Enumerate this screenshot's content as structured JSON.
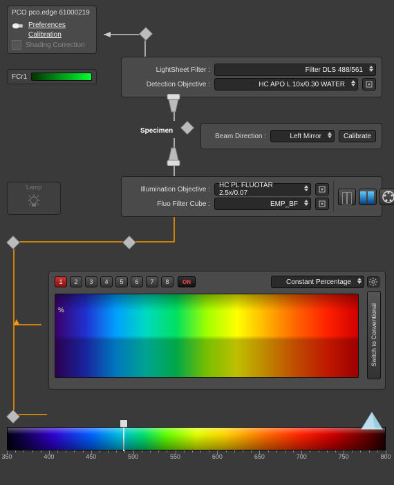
{
  "camera": {
    "title": "PCO pco.edge 61000219",
    "preferences": "Preferences",
    "calibration": "Calibration",
    "shading": "Shading Correction"
  },
  "fcr": {
    "label": "FCr1"
  },
  "detection": {
    "lightsheet_label": "LightSheet Filter :",
    "lightsheet_value": "Filter DLS  488/561",
    "objective_label": "Detection Objective :",
    "objective_value": "HC APO L   10x/0.30 WATER"
  },
  "specimen_label": "Specimen",
  "beam": {
    "label": "Beam Direction :",
    "value": "Left Mirror",
    "calibrate": "Calibrate"
  },
  "illumination": {
    "objective_label": "Illumination Objective :",
    "objective_value": "HC PL FLUOTAR   2.5x/0.07",
    "cube_label": "Fluo Filter Cube :",
    "cube_value": "EMP_BF"
  },
  "lamp": {
    "title": "Lamp"
  },
  "laser": {
    "buttons": [
      "1",
      "2",
      "3",
      "4",
      "5",
      "6",
      "7",
      "8"
    ],
    "active_index": 0,
    "on_label": "ON",
    "mode": "Constant Percentage",
    "percent_symbol": "%",
    "switch_label": "Switch to Conventional"
  },
  "ruler": {
    "min": 350,
    "max": 800,
    "labels": [
      350,
      400,
      450,
      500,
      550,
      600,
      650,
      700,
      750,
      800
    ],
    "marker_nm": 488
  }
}
